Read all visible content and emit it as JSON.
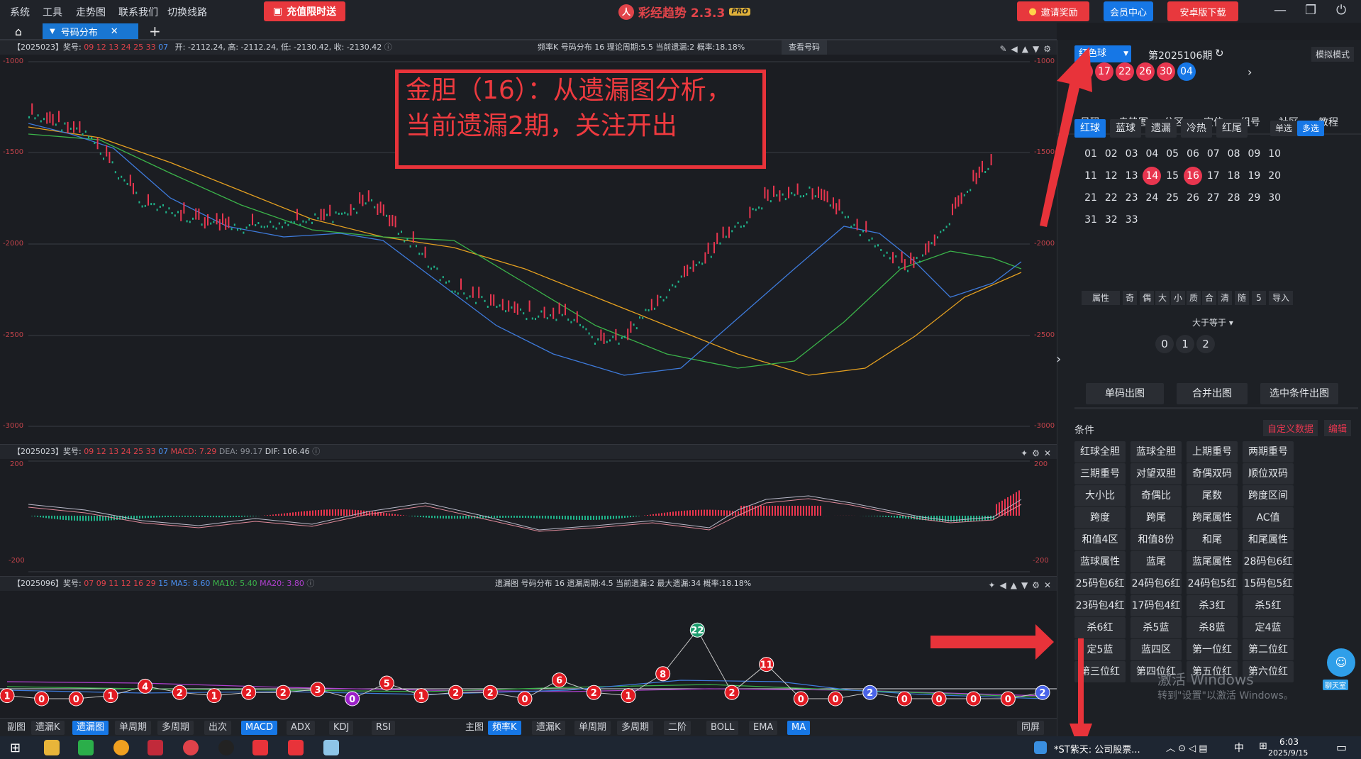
{
  "menu": {
    "items": [
      "系统",
      "工具",
      "走势图",
      "联系我们",
      "切换线路"
    ],
    "promo": "充值限时送",
    "app_title": "彩经趋势 2.3.3",
    "pro_badge": "PRO",
    "invite": "邀请奖励",
    "member": "会员中心",
    "android": "安卓版下载"
  },
  "tabs": {
    "active": "号码分布"
  },
  "main_panel": {
    "issue": "【2025023】奖号:",
    "numbers": "09 12 13 24 25 33",
    "blue": "07",
    "ohlc": "开: -2112.24, 高: -2112.24, 低: -2130.42, 收: -2130.42",
    "right_info": "频率K  号码分布  16    理论周期:5.5  当前遗漏:2  概率:18.18%",
    "view_btn": "查看号码",
    "y_ticks": [
      "-1000",
      "-1500",
      "-2000",
      "-2500",
      "-3000"
    ]
  },
  "macd_panel": {
    "issue": "【2025023】奖号:",
    "numbers": "09 12 13 24 25 33",
    "blue": "07",
    "macd": "MACD: 7.29",
    "dea": "DEA: 99.17",
    "dif": "DIF: 106.46",
    "y_ticks": [
      "200",
      "-200"
    ]
  },
  "miss_panel": {
    "issue": "【2025096】奖号:",
    "numbers": "07 09 11 12 16 29",
    "blue": "15",
    "ma5": "MA5: 8.60",
    "ma10": "MA10: 5.40",
    "ma20": "MA20: 3.80",
    "right_info": "遗漏图  号码分布  16    遗漏周期:4.5  当前遗漏:2  最大遗漏:34  概率:18.18%",
    "points": [
      {
        "v": 1,
        "c": "#e21b23"
      },
      {
        "v": 0,
        "c": "#e21b23"
      },
      {
        "v": 0,
        "c": "#e21b23"
      },
      {
        "v": 1,
        "c": "#e21b23"
      },
      {
        "v": 4,
        "c": "#e21b23"
      },
      {
        "v": 2,
        "c": "#e21b23"
      },
      {
        "v": 1,
        "c": "#e21b23"
      },
      {
        "v": 2,
        "c": "#e21b23"
      },
      {
        "v": 2,
        "c": "#e21b23"
      },
      {
        "v": 3,
        "c": "#e21b23"
      },
      {
        "v": 0,
        "c": "#9b20c8"
      },
      {
        "v": 5,
        "c": "#e21b23"
      },
      {
        "v": 1,
        "c": "#e21b23"
      },
      {
        "v": 2,
        "c": "#e21b23"
      },
      {
        "v": 2,
        "c": "#e21b23"
      },
      {
        "v": 0,
        "c": "#e21b23"
      },
      {
        "v": 6,
        "c": "#e21b23"
      },
      {
        "v": 2,
        "c": "#e21b23"
      },
      {
        "v": 1,
        "c": "#e21b23"
      },
      {
        "v": 8,
        "c": "#e21b23"
      },
      {
        "v": 22,
        "c": "#1e9c6e"
      },
      {
        "v": 2,
        "c": "#e21b23"
      },
      {
        "v": 11,
        "c": "#e21b23"
      },
      {
        "v": 0,
        "c": "#e21b23"
      },
      {
        "v": 0,
        "c": "#e21b23"
      },
      {
        "v": 2,
        "c": "#4a64e8"
      },
      {
        "v": 0,
        "c": "#e21b23"
      },
      {
        "v": 0,
        "c": "#e21b23"
      },
      {
        "v": 0,
        "c": "#e21b23"
      },
      {
        "v": 0,
        "c": "#e21b23"
      },
      {
        "v": 2,
        "c": "#4a64e8"
      }
    ]
  },
  "toolbar": {
    "sub_label": "副图",
    "sub_items": [
      "遗漏K",
      "遗漏图",
      "单周期",
      "多周期",
      "出次",
      "MACD",
      "ADX",
      "KDJ",
      "RSI"
    ],
    "main_label": "主图",
    "main_items": [
      "频率K",
      "遗漏K",
      "单周期",
      "多周期",
      "二阶",
      "BOLL",
      "EMA",
      "MA"
    ],
    "same_screen": "同屏"
  },
  "annotation": {
    "line1": "金胆（16）：从遗漏图分析，",
    "line2": "当前遗漏2期，关注开出"
  },
  "right": {
    "ball_select": "红色球",
    "period": "第2025106期",
    "mode": "模拟模式",
    "draw": [
      "05",
      "17",
      "22",
      "26",
      "30"
    ],
    "draw_blue": "04",
    "nav": [
      "号码",
      "走势图",
      "分区",
      "定位",
      "组号",
      "社区",
      "教程"
    ],
    "sub_tabs": [
      "红球",
      "蓝球",
      "遗漏",
      "冷热",
      "红尾"
    ],
    "single": "单选",
    "multi": "多选",
    "grid": [
      "01",
      "02",
      "03",
      "04",
      "05",
      "06",
      "07",
      "08",
      "09",
      "10",
      "11",
      "12",
      "13",
      "14",
      "15",
      "16",
      "17",
      "18",
      "19",
      "20",
      "21",
      "22",
      "23",
      "24",
      "25",
      "26",
      "27",
      "28",
      "29",
      "30",
      "31",
      "32",
      "33"
    ],
    "selected": [
      "14",
      "16"
    ],
    "attr_row": [
      "属性",
      "奇",
      "偶",
      "大",
      "小",
      "质",
      "合",
      "清",
      "随",
      "5",
      "导入"
    ],
    "gte": "大于等于",
    "counts": [
      "0",
      "1",
      "2"
    ],
    "actions": [
      "单码出图",
      "合并出图",
      "选中条件出图"
    ],
    "cond_title": "条件",
    "custom": "自定义数据",
    "edit": "编辑",
    "cond": [
      "红球全胆",
      "蓝球全胆",
      "上期重号",
      "两期重号",
      "三期重号",
      "对望双胆",
      "奇偶双码",
      "顺位双码",
      "大小比",
      "奇偶比",
      "尾数",
      "跨度区间",
      "跨度",
      "跨尾",
      "跨尾属性",
      "AC值",
      "和值4区",
      "和值8份",
      "和尾",
      "和尾属性",
      "蓝球属性",
      "蓝尾",
      "蓝尾属性",
      "28码包6红",
      "25码包6红",
      "24码包6红",
      "24码包5红",
      "15码包5红",
      "23码包4红",
      "17码包4红",
      "杀3红",
      "杀5红",
      "杀6红",
      "杀5蓝",
      "杀8蓝",
      "定4蓝",
      "定5蓝",
      "蓝四区",
      "第一位红",
      "第二位红",
      "第三位红",
      "第四位红",
      "第五位红",
      "第六位红"
    ],
    "chat": "聊天室"
  },
  "watermark": {
    "line1": "激活 Windows",
    "line2": "转到\"设置\"以激活 Windows。"
  },
  "taskbar": {
    "news": "*ST紫天: 公司股票...",
    "ime": "中",
    "time": "6:03",
    "date": "2025/9/15"
  }
}
